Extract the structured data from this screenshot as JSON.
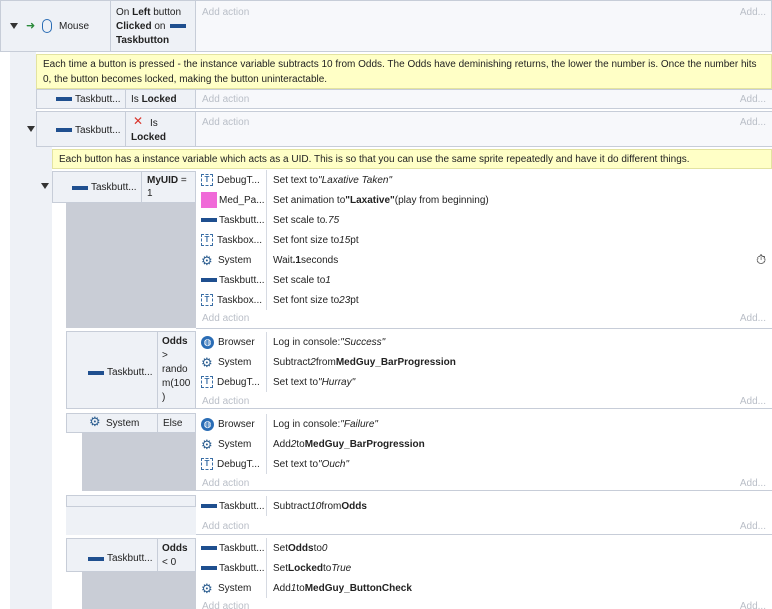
{
  "event1": {
    "object": "Mouse",
    "condition_parts": [
      "On ",
      "Left",
      " button ",
      "Clicked",
      " on ",
      "Taskbutton"
    ],
    "add_action": "Add action",
    "add_short": "Add..."
  },
  "comment1": "Each time a button is pressed - the instance variable subtracts 10 from Odds. The Odds have deminishing returns, the lower the number is. Once the number hits 0, the button becomes locked, making the button uninteractable.",
  "event2": {
    "object": "Taskbutt...",
    "cond_prefix": "Is ",
    "cond_bold": "Locked",
    "add_action": "Add action",
    "add_short": "Add..."
  },
  "event3": {
    "object": "Taskbutt...",
    "cross": "✕",
    "cond_prefix": "Is",
    "cond_bold": "Locked",
    "add_action": "Add action",
    "add_short": "Add..."
  },
  "comment2": "Each button has a instance variable which acts as a UID. This is so that you can use the same sprite repeatedly and have it do different things.",
  "event4": {
    "object": "Taskbutt...",
    "cond_bold": "MyUID",
    "cond_rest": " =",
    "cond_line2": "1",
    "actions": [
      {
        "icon": "text",
        "obj": "DebugT...",
        "pre": "Set text to ",
        "it": "\"Laxative Taken\"",
        "b": "",
        "post": ""
      },
      {
        "icon": "pink",
        "obj": "Med_Pa...",
        "pre": "Set animation to ",
        "it": "",
        "b": "\"Laxative\"",
        "post": " (play from beginning)"
      },
      {
        "icon": "sprite",
        "obj": "Taskbutt...",
        "pre": "Set scale to ",
        "it": ".75",
        "b": "",
        "post": ""
      },
      {
        "icon": "text",
        "obj": "Taskbox...",
        "pre": "Set font size to ",
        "it": "15",
        "b": "",
        "post": " pt"
      },
      {
        "icon": "gear",
        "obj": "System",
        "pre": "Wait ",
        "it": "",
        "b": ".1",
        "post": " seconds"
      },
      {
        "icon": "sprite",
        "obj": "Taskbutt...",
        "pre": "Set scale to ",
        "it": "1",
        "b": "",
        "post": ""
      },
      {
        "icon": "text",
        "obj": "Taskbox...",
        "pre": "Set font size to ",
        "it": "23",
        "b": "",
        "post": " pt"
      }
    ],
    "add_action": "Add action",
    "add_short": "Add...",
    "timer_icon": "⏱"
  },
  "event5": {
    "object": "Taskbutt...",
    "cond_lines": [
      "Odds",
      ">",
      "rando",
      "m(100",
      ")"
    ],
    "actions": [
      {
        "icon": "globe",
        "obj": "Browser",
        "pre": "Log in console: ",
        "it": "\"Success\"",
        "b": "",
        "post": ""
      },
      {
        "icon": "gear",
        "obj": "System",
        "pre": "Subtract ",
        "it": "2",
        "b": "",
        "post": " from ",
        "b2": "MedGuy_BarProgression"
      },
      {
        "icon": "text",
        "obj": "DebugT...",
        "pre": "Set text to ",
        "it": "\"Hurray\"",
        "b": "",
        "post": ""
      }
    ],
    "add_action": "Add action",
    "add_short": "Add..."
  },
  "event6": {
    "object": "System",
    "cond": "Else",
    "actions": [
      {
        "icon": "globe",
        "obj": "Browser",
        "pre": "Log in console: ",
        "it": "\"Failure\"",
        "b": "",
        "post": ""
      },
      {
        "icon": "gear",
        "obj": "System",
        "pre": "Add ",
        "it": "2",
        "b": "",
        "post": " to ",
        "b2": "MedGuy_BarProgression"
      },
      {
        "icon": "text",
        "obj": "DebugT...",
        "pre": "Set text to ",
        "it": "\"Ouch\"",
        "b": "",
        "post": ""
      }
    ],
    "add_action": "Add action",
    "add_short": "Add..."
  },
  "event7": {
    "actions": [
      {
        "icon": "sprite",
        "obj": "Taskbutt...",
        "pre": "Subtract ",
        "it": "10",
        "b": "",
        "post": " from ",
        "b2": "Odds"
      }
    ],
    "add_action": "Add action",
    "add_short": "Add..."
  },
  "event8": {
    "object": "Taskbutt...",
    "cond_lines_b": "Odds",
    "cond_line2": "< 0",
    "actions": [
      {
        "icon": "sprite",
        "obj": "Taskbutt...",
        "pre": "Set ",
        "it": "",
        "b": "Odds",
        "post": " to ",
        "it2": "0"
      },
      {
        "icon": "sprite",
        "obj": "Taskbutt...",
        "pre": "Set ",
        "it": "",
        "b": "Locked",
        "post": " to ",
        "it2": "True"
      },
      {
        "icon": "gear",
        "obj": "System",
        "pre": "Add ",
        "it": "1",
        "b": "",
        "post": " to ",
        "b2": "MedGuy_ButtonCheck"
      }
    ],
    "add_action": "Add action",
    "add_short": "Add..."
  },
  "colors": {
    "event_bg": "#eef1f6",
    "comment_bg": "#ffffc6",
    "sprite_blue": "#1f4f8f",
    "pink": "#f06ad8",
    "cross_red": "#d9342b"
  }
}
